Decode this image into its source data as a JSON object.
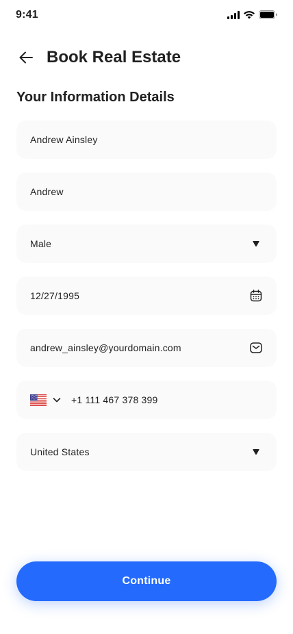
{
  "status_bar": {
    "time": "9:41"
  },
  "header": {
    "title": "Book Real Estate"
  },
  "form": {
    "section_title": "Your Information Details",
    "full_name": "Andrew Ainsley",
    "nickname": "Andrew",
    "gender": "Male",
    "date_of_birth": "12/27/1995",
    "email": "andrew_ainsley@yourdomain.com",
    "phone": "+1 111 467 378 399",
    "country": "United States"
  },
  "continue_label": "Continue",
  "icons": {
    "back": "arrow-left-icon",
    "dropdown": "caret-down-icon",
    "calendar": "calendar-icon",
    "email": "message-icon",
    "flag": "us-flag-icon"
  },
  "colors": {
    "primary": "#246bfd",
    "field_bg": "#fafafa",
    "text": "#212121"
  }
}
